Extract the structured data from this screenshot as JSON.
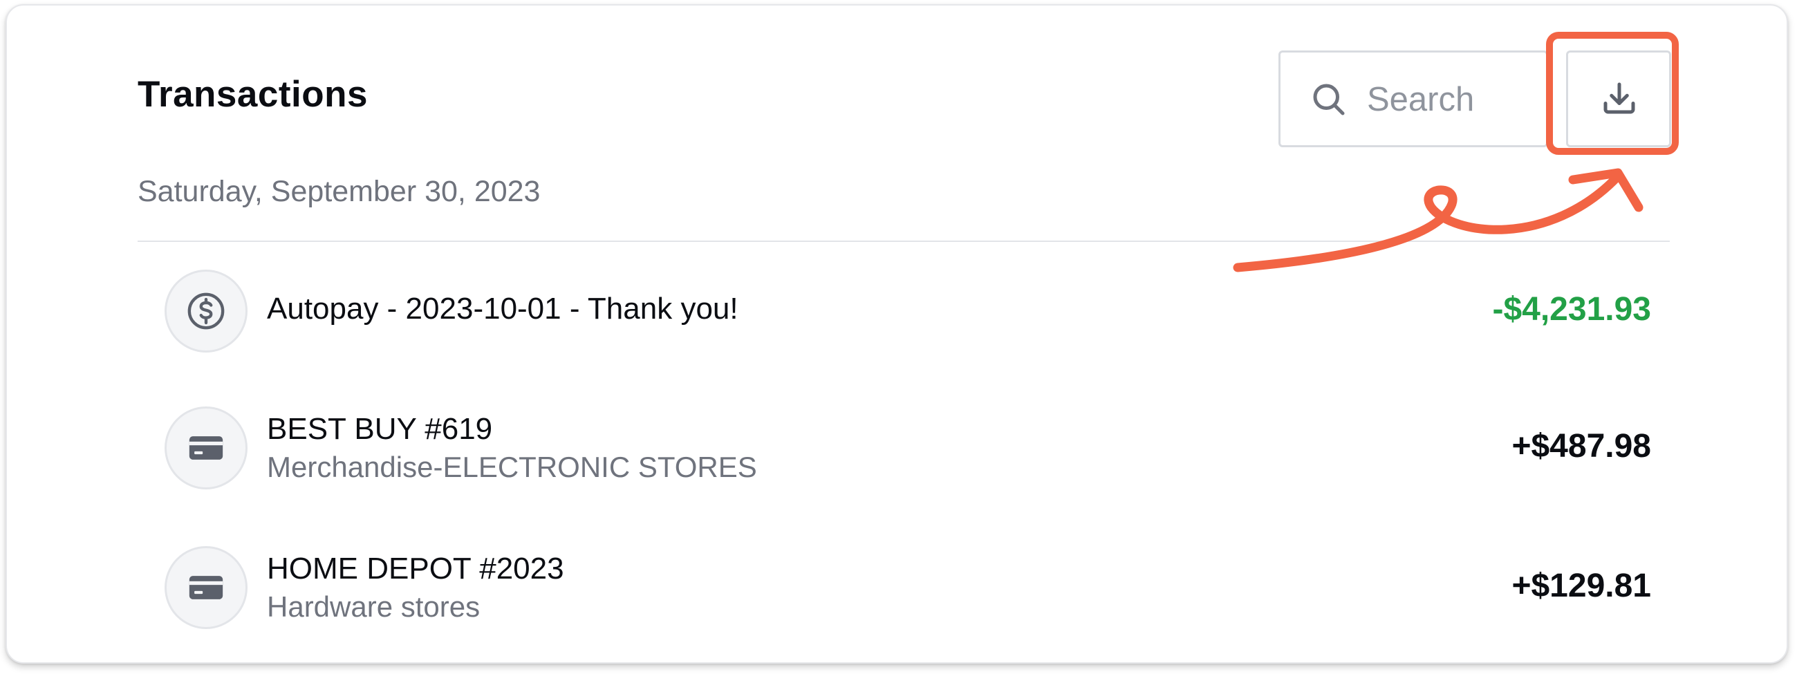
{
  "header": {
    "title": "Transactions"
  },
  "search": {
    "placeholder": "Search",
    "icon": "search-icon"
  },
  "toolbar": {
    "download_icon": "download-icon",
    "highlight_color": "#f26444"
  },
  "date_group": {
    "label": "Saturday, September 30, 2023"
  },
  "transactions": [
    {
      "icon": "dollar-circle-icon",
      "name": "Autopay - 2023-10-01 - Thank you!",
      "category": "",
      "amount": "-$4,231.93",
      "amount_color": "#22a046"
    },
    {
      "icon": "credit-card-icon",
      "name": "BEST BUY #619",
      "category": "Merchandise-ELECTRONIC STORES",
      "amount": "+$487.98",
      "amount_color": "#0b0d12"
    },
    {
      "icon": "credit-card-icon",
      "name": "HOME DEPOT #2023",
      "category": "Hardware stores",
      "amount": "+$129.81",
      "amount_color": "#0b0d12"
    }
  ]
}
